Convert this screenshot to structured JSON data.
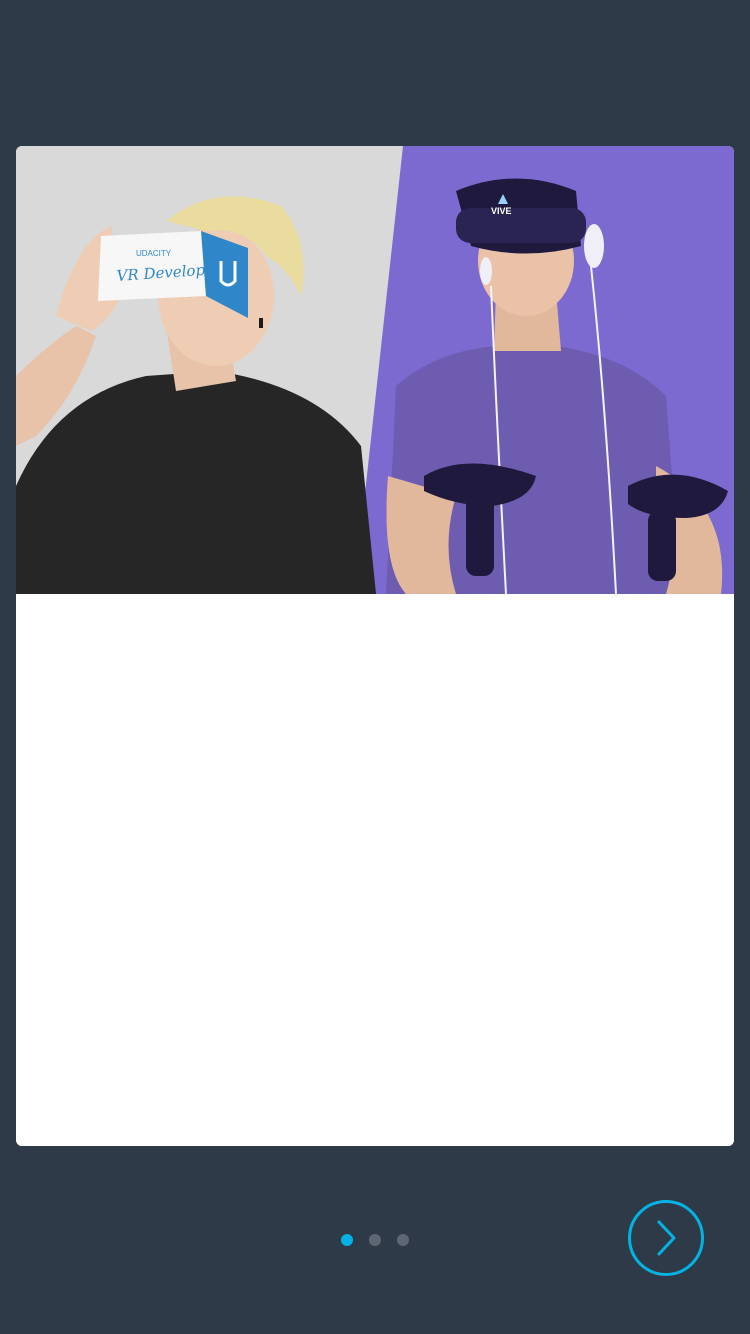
{
  "colors": {
    "background": "#2e3a47",
    "card": "#ffffff",
    "accent": "#02b3e4",
    "dot_inactive": "#5d6772",
    "hero_left": "#dcdcdc",
    "hero_right": "#7d6ad0"
  },
  "hero": {
    "cardboard_brand": "UDACITY",
    "cardboard_label": "VR Developer",
    "headset_brand": "VIVE"
  },
  "pager": {
    "total": 3,
    "active_index": 0
  },
  "next_button": {
    "icon": "chevron-right-icon"
  }
}
